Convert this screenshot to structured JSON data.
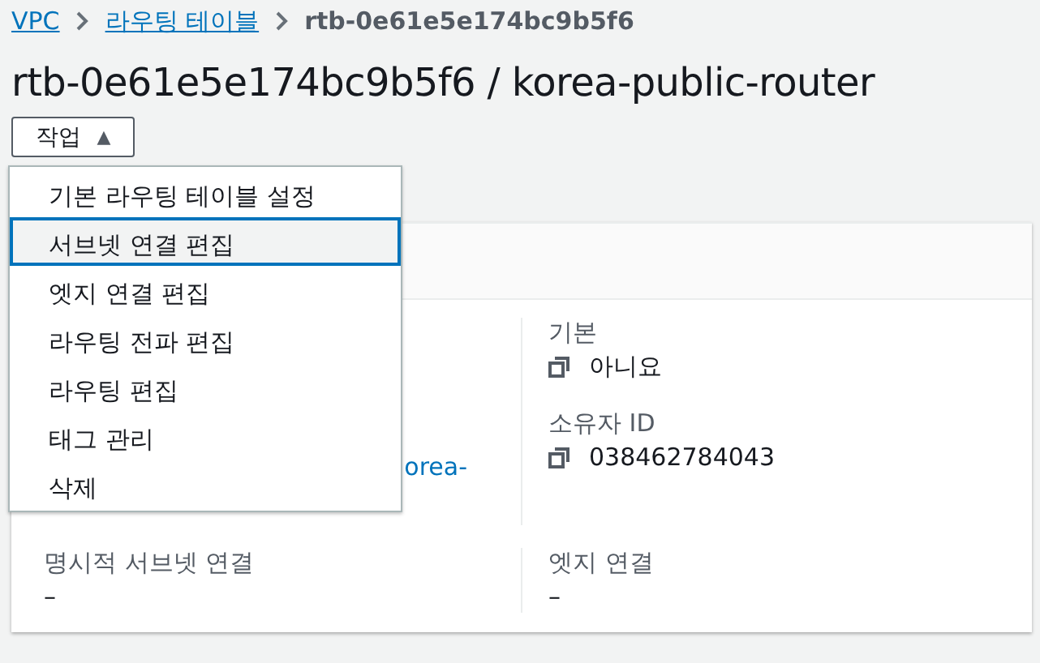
{
  "breadcrumb": [
    {
      "label": "VPC",
      "kind": "link"
    },
    {
      "label": "라우팅 테이블",
      "kind": "link"
    },
    {
      "label": "rtb-0e61e5e174bc9b5f6",
      "kind": "current"
    }
  ],
  "title": "rtb-0e61e5e174bc9b5f6 / korea-public-router",
  "actions_button": {
    "label": "작업",
    "icon": "▲",
    "expanded": true
  },
  "actions_menu": [
    {
      "label": "기본 라우팅 테이블 설정",
      "selected": false
    },
    {
      "label": "서브넷 연결 편집",
      "selected": true
    },
    {
      "label": "엣지 연결 편집",
      "selected": false
    },
    {
      "label": "라우팅 전파 편집",
      "selected": false
    },
    {
      "label": "라우팅 편집",
      "selected": false
    },
    {
      "label": "태그 관리",
      "selected": false
    },
    {
      "label": "삭제",
      "selected": false
    }
  ],
  "details": {
    "rows": [
      {
        "cells": [
          {
            "items": [
              {
                "kind": "link",
                "text": "orea-"
              }
            ]
          },
          {
            "items": [
              {
                "kind": "field",
                "label": "기본",
                "value": "아니요",
                "copyable": true
              },
              {
                "kind": "field",
                "label": "소유자 ID",
                "value": "038462784043",
                "copyable": true
              }
            ]
          }
        ]
      },
      {
        "cells": [
          {
            "items": [
              {
                "kind": "field",
                "label": "명시적 서브넷 연결",
                "value": "–",
                "copyable": false
              }
            ]
          },
          {
            "items": [
              {
                "kind": "field",
                "label": "엣지 연결",
                "value": "–",
                "copyable": false
              }
            ]
          }
        ]
      }
    ]
  }
}
